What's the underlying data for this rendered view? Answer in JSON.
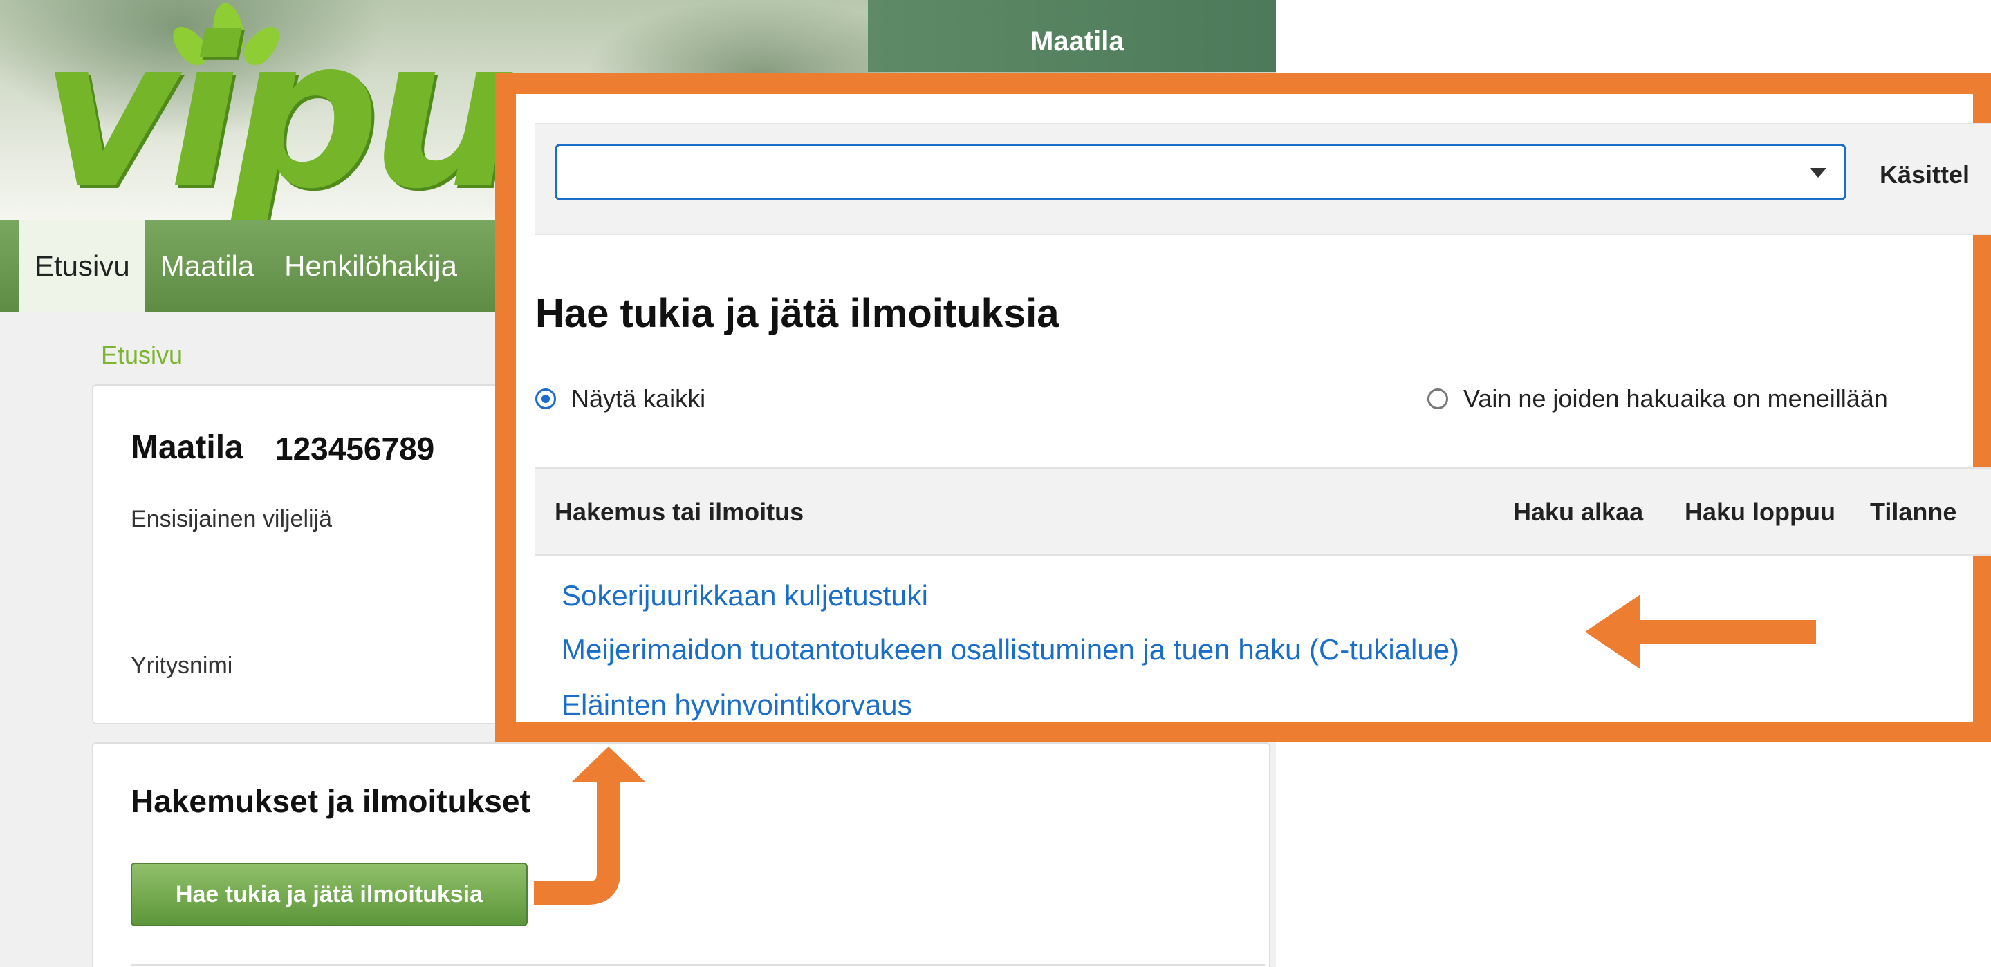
{
  "header": {
    "logo_text": "vipu",
    "section_label": "Maatila"
  },
  "nav": {
    "items": [
      {
        "label": "Etusivu",
        "active": true
      },
      {
        "label": "Maatila",
        "active": false
      },
      {
        "label": "Henkilöhakija",
        "active": false
      }
    ]
  },
  "breadcrumb": "Etusivu",
  "farm_card": {
    "title": "Maatila",
    "farm_id": "123456789",
    "primary_farmer_label": "Ensisijainen viljelijä",
    "company_name_label": "Yritysnimi"
  },
  "applications_card": {
    "title": "Hakemukset ja ilmoitukset",
    "button_label": "Hae tukia ja jätä ilmoituksia"
  },
  "overlay": {
    "select_value": "",
    "side_label": "Käsittel",
    "title": "Hae tukia ja jätä ilmoituksia",
    "filters": [
      {
        "label": "Näytä kaikki",
        "checked": true
      },
      {
        "label": "Vain ne joiden hakuaika on meneillään",
        "checked": false
      }
    ],
    "columns": [
      "Hakemus tai ilmoitus",
      "Haku alkaa",
      "Haku loppuu",
      "Tilanne"
    ],
    "rows": [
      "Sokerijuurikkaan kuljetustuki",
      "Meijerimaidon tuotantotukeen osallistuminen ja tuen haku (C-tukialue)",
      "Eläinten hyvinvointikorvaus"
    ]
  },
  "colors": {
    "accent_orange": "#ed7d31",
    "link_blue": "#1a6ec9",
    "brand_green": "#74b52a",
    "nav_green": "#6b9a50"
  }
}
